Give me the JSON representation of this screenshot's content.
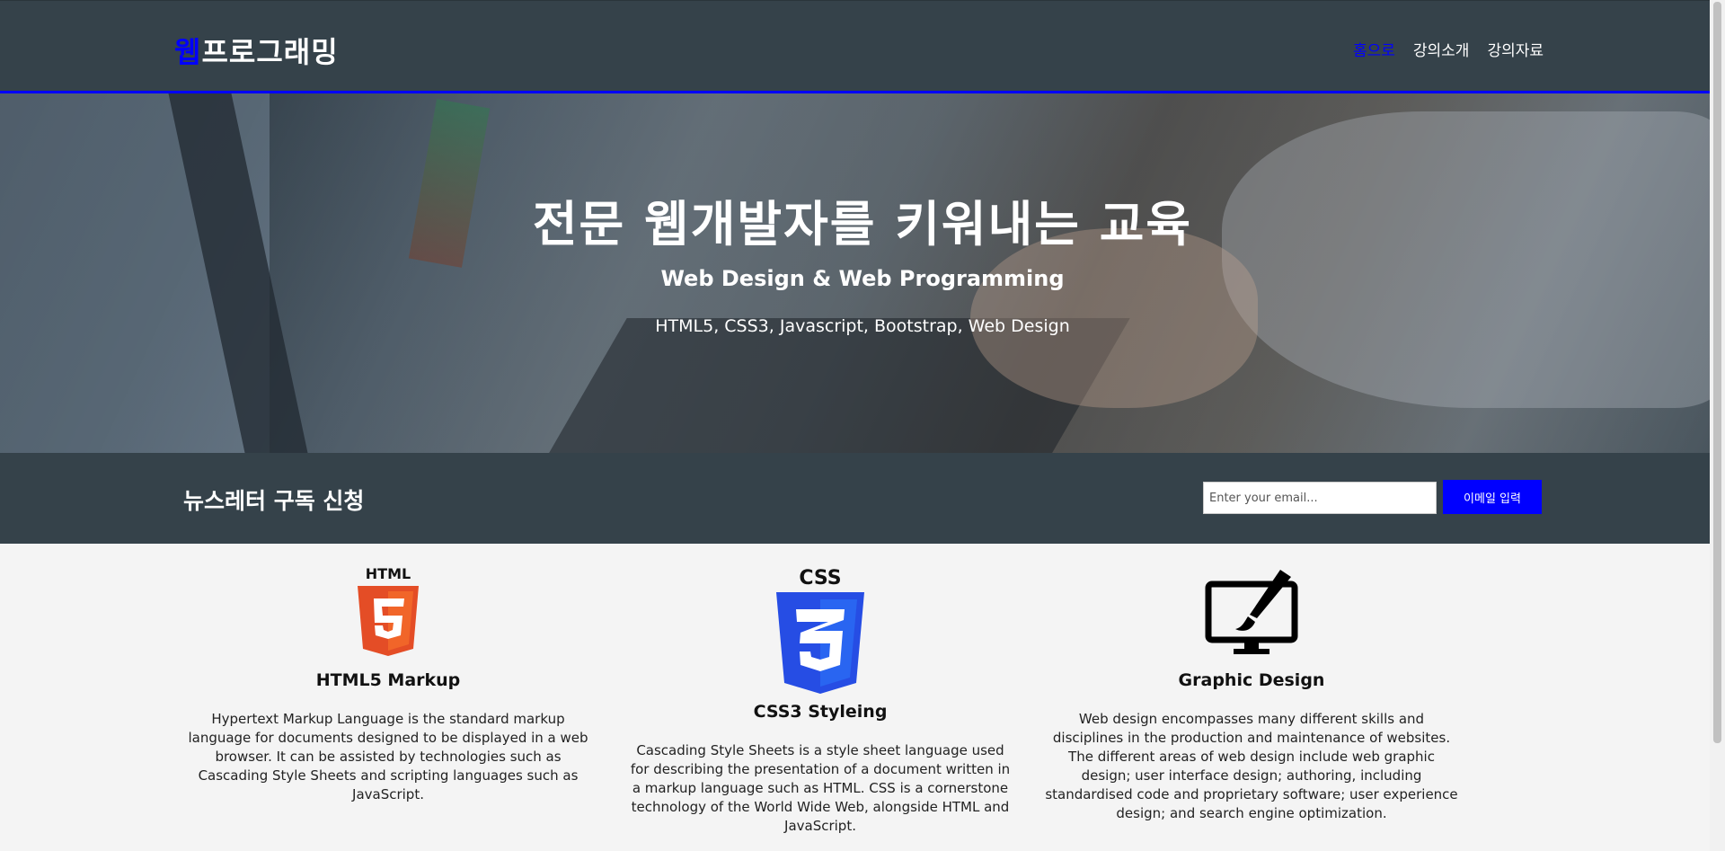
{
  "header": {
    "logo_highlight": "웹",
    "logo_rest": "프로그래밍",
    "nav": [
      {
        "label": "홈으로",
        "current": true
      },
      {
        "label": "강의소개",
        "current": false
      },
      {
        "label": "강의자료",
        "current": false
      }
    ]
  },
  "hero": {
    "title": "전문 웹개발자를 키워내는 교육",
    "subtitle": "Web Design & Web Programming",
    "description": "HTML5, CSS3, Javascript, Bootstrap, Web Design"
  },
  "newsletter": {
    "title": "뉴스레터 구독 신청",
    "email_placeholder": "Enter your email...",
    "button_label": "이메일 입력"
  },
  "boxes": [
    {
      "icon": "html5-icon",
      "icon_text": "HTML",
      "title": "HTML5 Markup",
      "text": "Hypertext Markup Language is the standard markup language for documents designed to be displayed in a web browser. It can be assisted by technologies such as Cascading Style Sheets and scripting languages such as JavaScript."
    },
    {
      "icon": "css3-icon",
      "icon_text": "CSS",
      "title": "CSS3 Styleing",
      "text": "Cascading Style Sheets is a style sheet language used for describing the presentation of a document written in a markup language such as HTML. CSS is a cornerstone technology of the World Wide Web, alongside HTML and JavaScript."
    },
    {
      "icon": "graphic-design-icon",
      "title": "Graphic Design",
      "text": "Web design encompasses many different skills and disciplines in the production and maintenance of websites. The different areas of web design include web graphic design; user interface design; authoring, including standardised code and proprietary software; user experience design; and search engine optimization."
    }
  ],
  "colors": {
    "header_bg": "#35424a",
    "accent": "#0000ff",
    "content_bg": "#f4f4f4"
  }
}
